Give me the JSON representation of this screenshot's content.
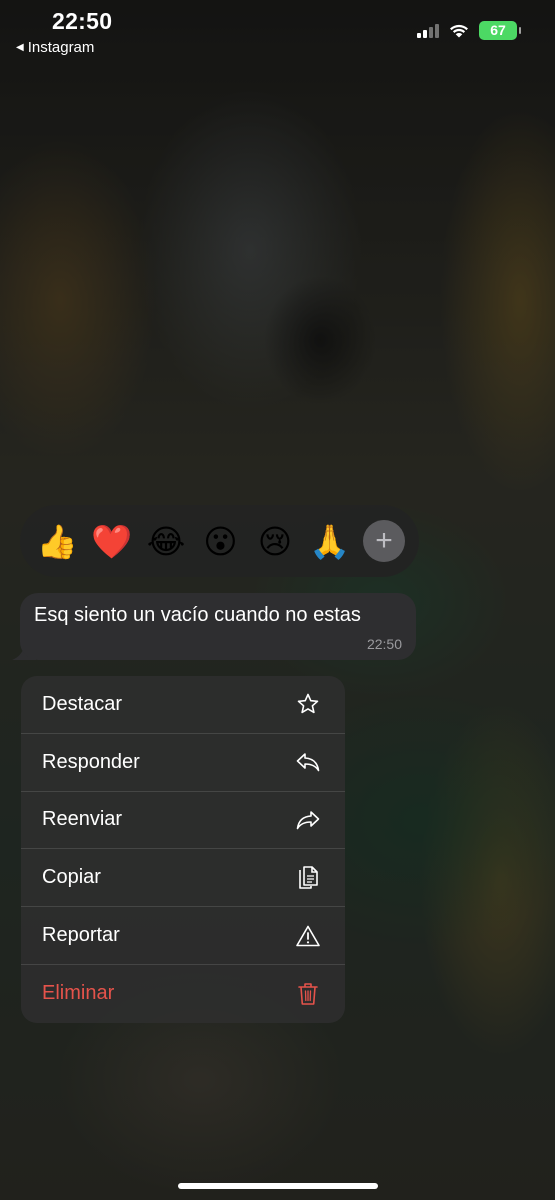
{
  "status_bar": {
    "time": "22:50",
    "back_app": "Instagram",
    "battery": "67"
  },
  "reactions": [
    {
      "emoji": "👍",
      "icon": "thumbs-up-icon"
    },
    {
      "emoji": "❤️",
      "icon": "red-heart-icon"
    },
    {
      "emoji": "😂",
      "icon": "tears-of-joy-icon"
    },
    {
      "emoji": "😮",
      "icon": "surprised-face-icon"
    },
    {
      "emoji": "😢",
      "icon": "crying-face-icon"
    },
    {
      "emoji": "🙏",
      "icon": "folded-hands-icon"
    }
  ],
  "reaction_add": "+",
  "message": {
    "text": "Esq siento un vacío cuando no estas",
    "time": "22:50"
  },
  "menu": {
    "items": [
      {
        "label": "Destacar",
        "icon": "star-icon"
      },
      {
        "label": "Responder",
        "icon": "reply-icon"
      },
      {
        "label": "Reenviar",
        "icon": "forward-icon"
      },
      {
        "label": "Copiar",
        "icon": "copy-icon"
      },
      {
        "label": "Reportar",
        "icon": "warning-icon"
      },
      {
        "label": "Eliminar",
        "icon": "trash-icon"
      }
    ]
  },
  "colors": {
    "danger": "#e5534b",
    "battery": "#4cd964",
    "bubble": "#2e2e30",
    "menu": "#2d2d2d"
  }
}
